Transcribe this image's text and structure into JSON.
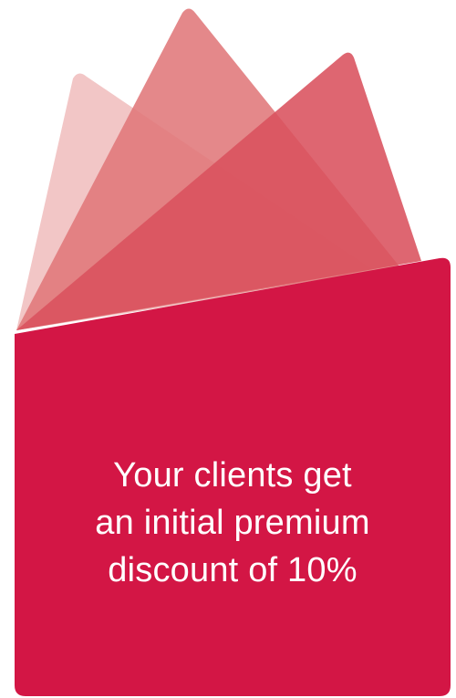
{
  "card": {
    "lines": [
      "Your clients get",
      "an initial premium",
      "discount of 10%"
    ]
  },
  "colors": {
    "card": "#d31645",
    "sheet_back": "#f2c6c6",
    "sheet_middle": "#e48a8a",
    "sheet_front": "#d9515d"
  },
  "icons": [
    "fanned-paper-sheets-graphic"
  ]
}
